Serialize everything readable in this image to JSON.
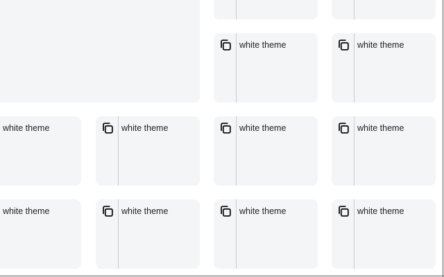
{
  "theme_cards": {
    "item_label": "white theme",
    "copy_icon": "copy-icon"
  },
  "colors": {
    "card_background": "#f4f5f7",
    "divider": "#c9ccd1",
    "text": "#1f1f1f"
  }
}
